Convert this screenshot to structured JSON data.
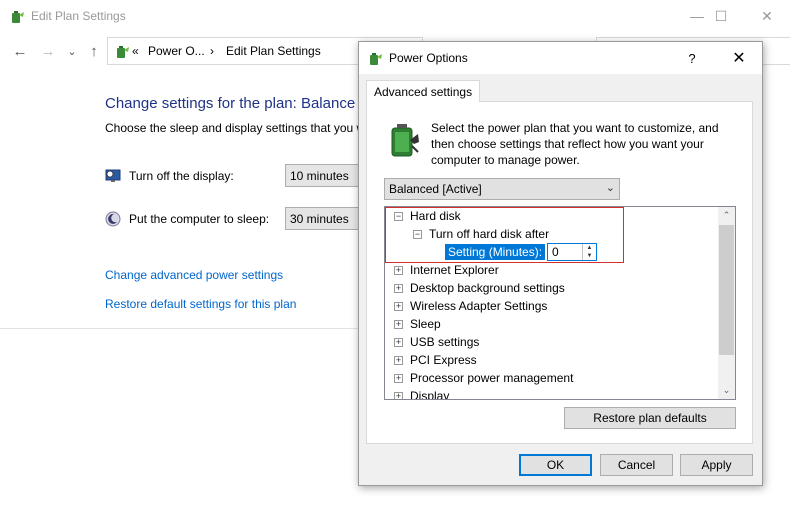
{
  "window": {
    "title": "Edit Plan Settings",
    "controls": {
      "minimize": "—",
      "maximize": "☐",
      "close": "✕"
    }
  },
  "navbar": {
    "back": "←",
    "forward": "→",
    "recent": "⌄",
    "up": "↑",
    "breadcrumb_sep": "«",
    "crumb1": "Power O...",
    "crumb_arrow": "›",
    "crumb2": "Edit Plan Settings"
  },
  "page": {
    "heading": "Change settings for the plan: Balance",
    "subtext": "Choose the sleep and display settings that you w",
    "display_label": "Turn off the display:",
    "display_value": "10 minutes",
    "sleep_label": "Put the computer to sleep:",
    "sleep_value": "30 minutes",
    "link_advanced": "Change advanced power settings",
    "link_restore": "Restore default settings for this plan"
  },
  "dialog": {
    "title": "Power Options",
    "help": "?",
    "close": "✕",
    "tab": "Advanced settings",
    "description": "Select the power plan that you want to customize, and then choose settings that reflect how you want your computer to manage power.",
    "plan_select": "Balanced [Active]",
    "select_arrow": "⌄",
    "tree": {
      "hard_disk": "Hard disk",
      "turn_off": "Turn off hard disk after",
      "setting_label": "Setting (Minutes):",
      "setting_value": "0",
      "items": [
        "Internet Explorer",
        "Desktop background settings",
        "Wireless Adapter Settings",
        "Sleep",
        "USB settings",
        "PCI Express",
        "Processor power management",
        "Display"
      ],
      "collapse_sign": "−",
      "expand_sign": "+",
      "spin_up": "▲",
      "spin_down": "▼",
      "scroll_up": "⌃",
      "scroll_down": "⌄"
    },
    "restore_button": "Restore plan defaults",
    "ok": "OK",
    "cancel": "Cancel",
    "apply": "Apply"
  }
}
